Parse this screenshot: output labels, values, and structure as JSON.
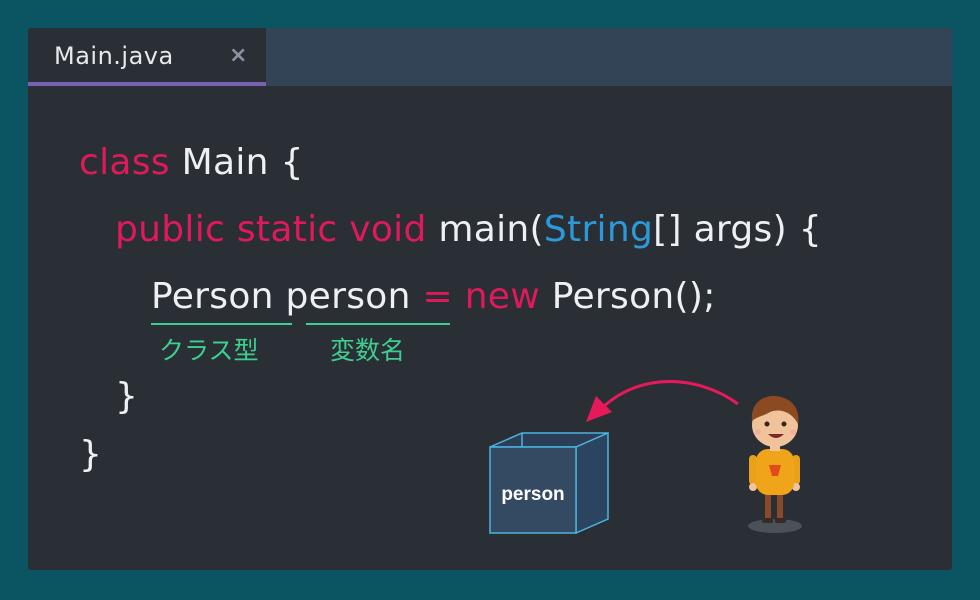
{
  "tab": {
    "filename": "Main.java",
    "close_glyph": "×"
  },
  "code": {
    "line1": {
      "kw": "class",
      "rest": " Main {"
    },
    "line2": {
      "kw": "public static void",
      "rest_a": " main(",
      "type": "String",
      "rest_b": "[] args) {"
    },
    "line3": {
      "class_type": "Person",
      "var_name": "person",
      "eq": " = ",
      "kw": "new",
      "rest": " Person();"
    },
    "line4": "}",
    "line5": "}"
  },
  "annotations": {
    "class_type_label": "クラス型",
    "var_name_label": "変数名"
  },
  "illustration": {
    "box_label": "person",
    "arrow_color": "#e8195b",
    "box_edge_color": "#4ab3e0"
  },
  "colors": {
    "background": "#0b5562",
    "editor_bg": "#2a2e35",
    "tabbar_bg": "#344457",
    "keyword": "#e0195a",
    "type": "#2c9ad9",
    "annotation": "#3ecf8e",
    "tab_accent": "#7a62b3"
  }
}
